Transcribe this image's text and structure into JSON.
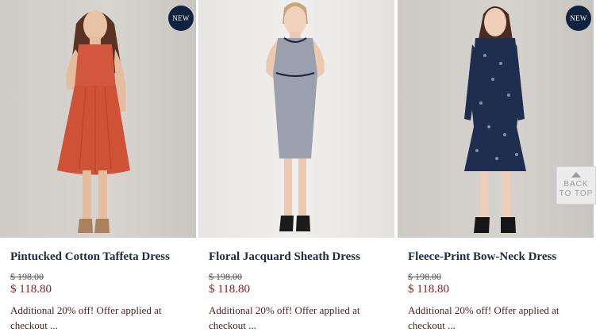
{
  "products": [
    {
      "title": "Pintucked Cotton Taffeta Dress",
      "old_price": "$ 198.00",
      "new_price": "$ 118.80",
      "offer": "Additional 20% off! Offer applied at checkout ...",
      "badge": "NEW",
      "dress_color": "#d3573c"
    },
    {
      "title": "Floral Jacquard Sheath Dress",
      "old_price": "$ 198.00",
      "new_price": "$ 118.80",
      "offer": "Additional 20% off! Offer applied at checkout ...",
      "badge": "",
      "dress_color": "#9aa0ad"
    },
    {
      "title": "Fleece-Print Bow-Neck Dress",
      "old_price": "$ 198.00",
      "new_price": "$ 118.80",
      "offer": "Additional 20% off! Offer applied at checkout ...",
      "badge": "NEW",
      "dress_color": "#1f2e4f"
    }
  ],
  "back_to_top": {
    "line1": "BACK",
    "line2": "TO TOP",
    "icon": "arrow-up-icon"
  },
  "colors": {
    "badge_bg": "#0f2340",
    "title": "#1a2b45",
    "sale_price": "#8a1a1a"
  }
}
